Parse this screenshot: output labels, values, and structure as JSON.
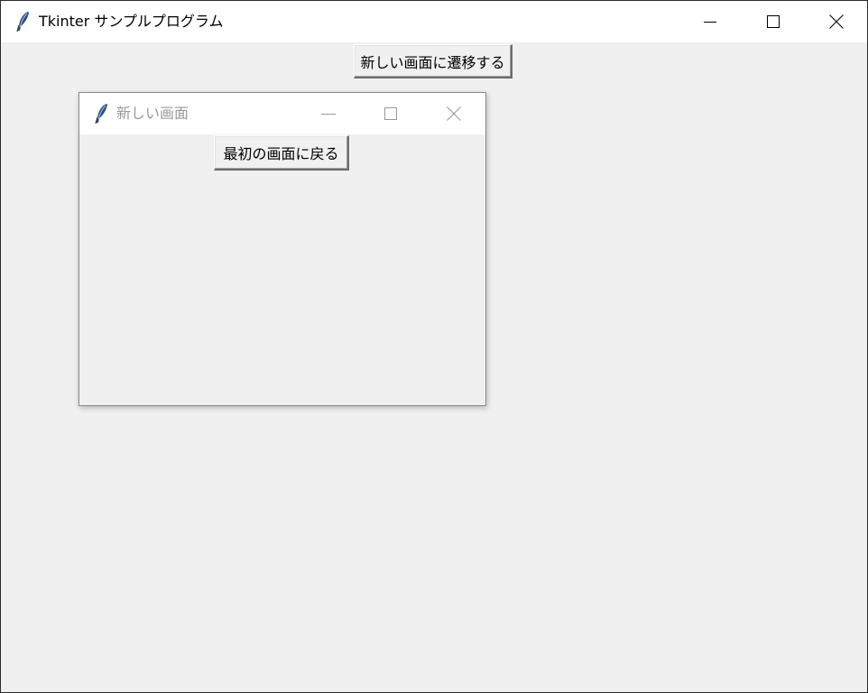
{
  "main_window": {
    "title": "Tkinter サンプルプログラム",
    "icon": "tk-feather-icon",
    "controls": [
      "minimize-icon",
      "maximize-icon",
      "close-icon"
    ],
    "button_label": "新しい画面に遷移する"
  },
  "sub_window": {
    "title": "新しい画面",
    "icon": "tk-feather-icon",
    "controls": [
      "minimize-icon",
      "maximize-icon",
      "close-icon"
    ],
    "button_label": "最初の画面に戻る",
    "active": false
  },
  "colors": {
    "background": "#f0f0f0",
    "titlebar": "#ffffff",
    "inactive_title_text": "#999999"
  }
}
